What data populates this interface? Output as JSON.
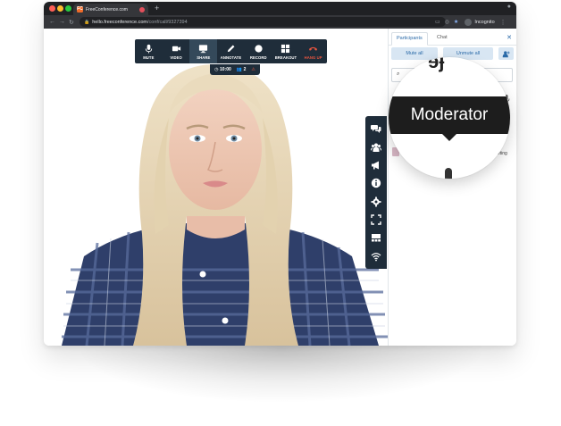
{
  "browser": {
    "tab_title": "FreeConference.com",
    "favicon_letter": "FC",
    "new_tab_symbol": "+",
    "url_host": "hello.freeconference.com",
    "url_path": "/conf/call/9327394",
    "profile_label": "Incognito"
  },
  "toolbar": {
    "items": [
      {
        "label": "MUTE",
        "icon": "mic-icon"
      },
      {
        "label": "VIDEO",
        "icon": "video-camera-icon"
      },
      {
        "label": "SHARE",
        "icon": "monitor-icon"
      },
      {
        "label": "ANNOTATE",
        "icon": "pencil-icon"
      },
      {
        "label": "RECORD",
        "icon": "record-icon"
      },
      {
        "label": "BREAKOUT",
        "icon": "grid-icon"
      },
      {
        "label": "HANG UP",
        "icon": "phone-hangup-icon"
      }
    ],
    "active_index": 2
  },
  "status": {
    "timer": "10:00",
    "participant_count": "2"
  },
  "side_rail": {
    "icons": [
      "chat-bubbles-icon",
      "people-icon",
      "megaphone-icon",
      "info-icon",
      "gear-icon",
      "fullscreen-icon",
      "layout-icon",
      "wifi-icon"
    ]
  },
  "panel": {
    "tab_participants": "Participants",
    "tab_chat": "Chat",
    "mute_all": "Mute all",
    "unmute_all": "Unmute all",
    "meeting_snippet": "meeting",
    "tooltip": "Moderator"
  },
  "colors": {
    "toolbar_bg": "#1f2d3a",
    "accent": "#2a6aa8",
    "hangup": "#e8553f"
  }
}
